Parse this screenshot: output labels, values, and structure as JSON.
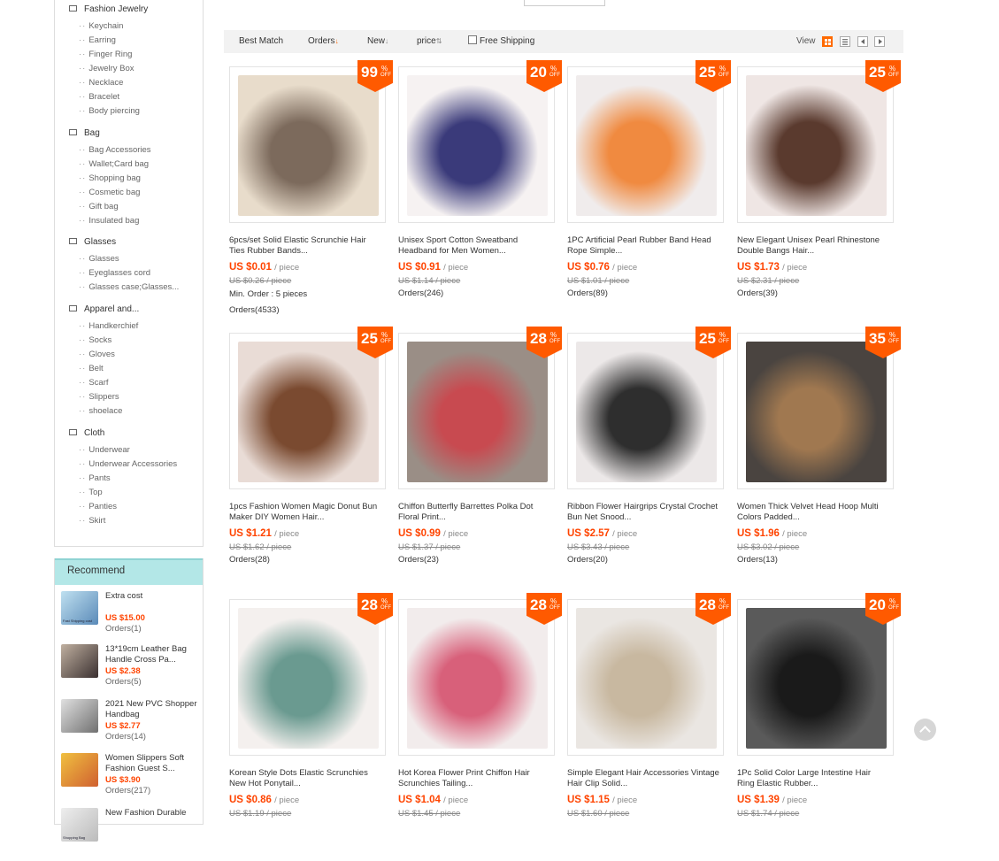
{
  "sidebar": {
    "categories": [
      {
        "label": "Fashion Jewelry",
        "items": [
          "Keychain",
          "Earring",
          "Finger Ring",
          "Jewelry Box",
          "Necklace",
          "Bracelet",
          "Body piercing"
        ]
      },
      {
        "label": "Bag",
        "items": [
          "Bag Accessories",
          "Wallet;Card bag",
          "Shopping bag",
          "Cosmetic bag",
          "Gift bag",
          "Insulated bag"
        ]
      },
      {
        "label": "Glasses",
        "items": [
          "Glasses",
          "Eyeglasses cord",
          "Glasses case;Glasses..."
        ]
      },
      {
        "label": "Apparel and...",
        "items": [
          "Handkerchief",
          "Socks",
          "Gloves",
          "Belt",
          "Scarf",
          "Slippers",
          "shoelace"
        ]
      },
      {
        "label": "Cloth",
        "items": [
          "Underwear",
          "Underwear Accessories",
          "Pants",
          "Top",
          "Panties",
          "Skirt"
        ]
      }
    ]
  },
  "recommend": {
    "title": "Recommend",
    "items": [
      {
        "title": "Extra cost",
        "price": "US $15.00",
        "orders": "Orders(1)",
        "thumb_label": "Fast Shipping cost"
      },
      {
        "title": "13*19cm Leather Bag Handle Cross Pa...",
        "price": "US $2.38",
        "orders": "Orders(5)"
      },
      {
        "title": "2021 New PVC Shopper Handbag",
        "price": "US $2.77",
        "orders": "Orders(14)"
      },
      {
        "title": "Women Slippers Soft Fashion Guest S...",
        "price": "US $3.90",
        "orders": "Orders(217)"
      },
      {
        "title": "New Fashion Durable",
        "thumb_label": "Shopping Bag"
      }
    ]
  },
  "toolbar": {
    "best_match": "Best Match",
    "orders": "Orders",
    "new": "New",
    "price": "price",
    "free_shipping": "Free Shipping",
    "view": "View",
    "arrow_down": "↓",
    "arrow_updown": "⇅"
  },
  "per_piece": "/ piece",
  "percent": "%",
  "off": "OFF",
  "products": [
    {
      "discount": "99",
      "title": "6pcs/set Solid Elastic Scrunchie Hair Ties Rubber Bands...",
      "price": "US $0.01",
      "orig": "US $0.26 / piece",
      "min_order": "Min. Order : 5 pieces",
      "orders": "Orders(4533)",
      "colors": [
        "#e8dccb",
        "#7c6a5c"
      ]
    },
    {
      "discount": "20",
      "title": "Unisex Sport Cotton Sweatband Headband for Men Women...",
      "price": "US $0.91",
      "orig": "US $1.14 / piece",
      "orders": "Orders(246)",
      "colors": [
        "#f6f2f2",
        "#3a3a7a"
      ]
    },
    {
      "discount": "25",
      "title": "1PC Artificial Pearl Rubber Band Head Rope Simple...",
      "price": "US $0.76",
      "orig": "US $1.01 / piece",
      "orders": "Orders(89)",
      "colors": [
        "#f0ecec",
        "#f08a40"
      ]
    },
    {
      "discount": "25",
      "title": "New Elegant Unisex Pearl Rhinestone Double Bangs Hair...",
      "price": "US $1.73",
      "orig": "US $2.31 / piece",
      "orders": "Orders(39)",
      "colors": [
        "#efe6e4",
        "#5a3a2e"
      ]
    },
    {
      "discount": "25",
      "title": "1pcs Fashion Women Magic Donut Bun Maker DIY Women Hair...",
      "price": "US $1.21",
      "orig": "US $1.62 / piece",
      "orders": "Orders(28)",
      "colors": [
        "#e9dcd6",
        "#7a4a30"
      ]
    },
    {
      "discount": "28",
      "title": "Chiffon Butterfly Barrettes Polka Dot Floral Print...",
      "price": "US $0.99",
      "orig": "US $1.37 / piece",
      "orders": "Orders(23)",
      "colors": [
        "#9a8e86",
        "#c84a50"
      ]
    },
    {
      "discount": "25",
      "title": "Ribbon Flower Hairgrips Crystal Crochet Bun Net Snood...",
      "price": "US $2.57",
      "orig": "US $3.43 / piece",
      "orders": "Orders(20)",
      "colors": [
        "#ece8e8",
        "#2e2e2e"
      ]
    },
    {
      "discount": "35",
      "title": "Women Thick Velvet Head Hoop Multi Colors Padded...",
      "price": "US $1.96",
      "orig": "US $3.02 / piece",
      "orders": "Orders(13)",
      "colors": [
        "#4a4440",
        "#a07850"
      ]
    },
    {
      "discount": "28",
      "title": "Korean Style Dots Elastic Scrunchies New Hot Ponytail...",
      "price": "US $0.86",
      "orig": "US $1.19 / piece",
      "orders": "",
      "colors": [
        "#f4f0ee",
        "#6a9a90"
      ]
    },
    {
      "discount": "28",
      "title": "Hot Korea Flower Print Chiffon Hair Scrunchies Tailing...",
      "price": "US $1.04",
      "orig": "US $1.45 / piece",
      "orders": "",
      "colors": [
        "#f2ecec",
        "#d8607a"
      ]
    },
    {
      "discount": "28",
      "title": "Simple Elegant Hair Accessories Vintage Hair Clip Solid...",
      "price": "US $1.15",
      "orig": "US $1.60 / piece",
      "orders": "",
      "colors": [
        "#eae6e2",
        "#c8b8a0"
      ]
    },
    {
      "discount": "20",
      "title": "1Pc Solid Color Large Intestine Hair Ring Elastic Rubber...",
      "price": "US $1.39",
      "orig": "US $1.74 / piece",
      "orders": "",
      "colors": [
        "#5a5a5a",
        "#1a1a1a"
      ]
    }
  ]
}
